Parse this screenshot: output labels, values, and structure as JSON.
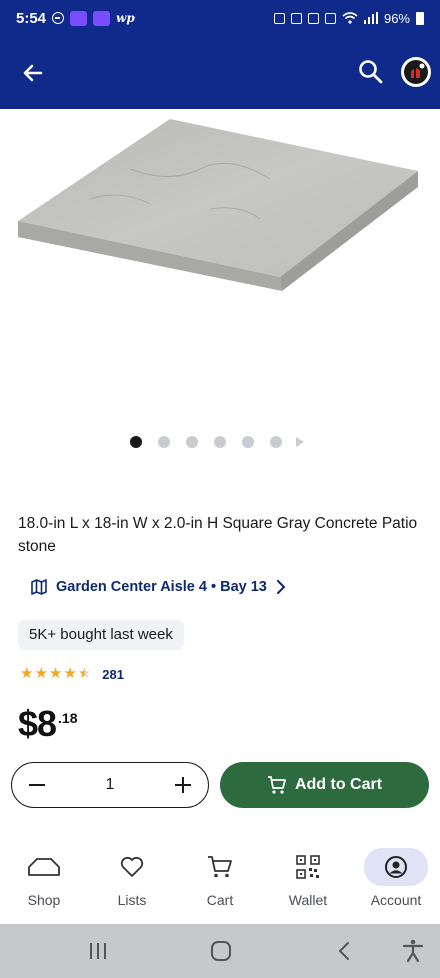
{
  "status_bar": {
    "time": "5:54",
    "app_text": "wp",
    "battery": "96%"
  },
  "header": {
    "back_label": "Back",
    "search_label": "Search",
    "profile_label": "Profile"
  },
  "gallery": {
    "image_name": "square gray concrete patio stone",
    "dot_count": 6,
    "active_index": 0
  },
  "product": {
    "title": "18.0-in L x 18-in W x 2.0-in H Square Gray Concrete Patio stone",
    "location": "Garden Center Aisle 4 • Bay 13",
    "bought_badge": "5K+ bought last week",
    "rating": 4.5,
    "review_count": "281",
    "price_dollars": "$8",
    "price_cents": ".18"
  },
  "purchase": {
    "quantity": "1",
    "add_to_cart_label": "Add to Cart"
  },
  "bottom_nav": {
    "items": [
      {
        "label": "Shop",
        "icon": "shop-icon"
      },
      {
        "label": "Lists",
        "icon": "heart-icon"
      },
      {
        "label": "Cart",
        "icon": "cart-icon"
      },
      {
        "label": "Wallet",
        "icon": "qr-code-icon"
      },
      {
        "label": "Account",
        "icon": "account-icon"
      }
    ],
    "active": "Account"
  },
  "colors": {
    "header_bg": "#0f2a8a",
    "add_to_cart_bg": "#2d6a3e",
    "link_blue": "#0f2a6e",
    "star": "#f5a623"
  }
}
